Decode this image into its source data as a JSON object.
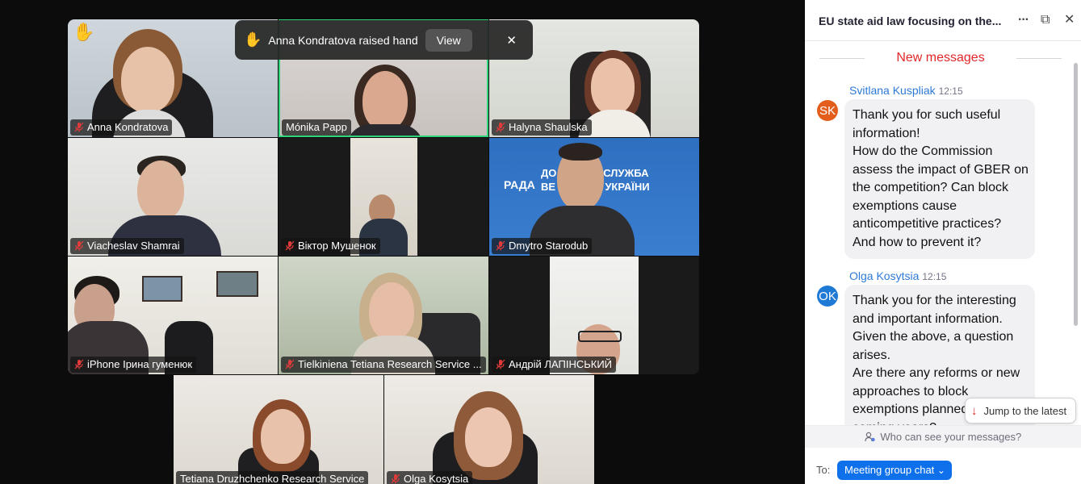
{
  "notification": {
    "hand_icon": "✋",
    "text": "Anna Kondratova raised hand",
    "view_label": "View",
    "close_icon": "✕"
  },
  "tiles": [
    {
      "name": "Anna Kondratova",
      "raised_hand": "✋"
    },
    {
      "name": "Mónika Papp"
    },
    {
      "name": "Halyna Shaulska"
    },
    {
      "name": "Viacheslav Shamrai"
    },
    {
      "name": "Віктор Мушенок"
    },
    {
      "name": "Dmytro Starodub",
      "banner_line1": "ДО     ЦЬКА СЛУЖБА",
      "banner_line2": "ВЕ      РАДИ УКРАЇНИ",
      "banner_left": "РАДА"
    },
    {
      "name": "iPhone Ірина гуменюк"
    },
    {
      "name": "Tielkiniena Tetiana Research Service ..."
    },
    {
      "name": "Андрій ЛАПІНСЬКИЙ"
    },
    {
      "name": "Tetiana Druzhchenko  Research Service"
    },
    {
      "name": "Olga Kosytsia"
    }
  ],
  "chat": {
    "title": "EU state aid law focusing on the...",
    "more_icon": "···",
    "popout_icon": "⧉",
    "close_icon": "✕",
    "new_messages_label": "New messages",
    "messages": [
      {
        "initials": "SK",
        "avatar_color": "#e35d1c",
        "sender": "Svitlana Kuspliak",
        "time": "12:15",
        "text": "Thank you for such useful information!\nHow do the Commission assess the impact of GBER on the competition? Can block exemptions cause anticompetitive practices?\n And how to prevent it?"
      },
      {
        "initials": "OK",
        "avatar_color": "#1f7ad6",
        "sender": "Olga Kosytsia",
        "time": "12:15",
        "text": "Thank you for the interesting and important information. Given the above, a question arises.\nAre there any reforms or new approaches to block exemptions planned in the coming years?"
      }
    ],
    "jump_label": "Jump to the latest",
    "jump_icon": "↓",
    "who_can_see": "Who can see your messages?",
    "to_label": "To:",
    "recipient": "Meeting group chat",
    "recipient_caret": "⌄"
  }
}
